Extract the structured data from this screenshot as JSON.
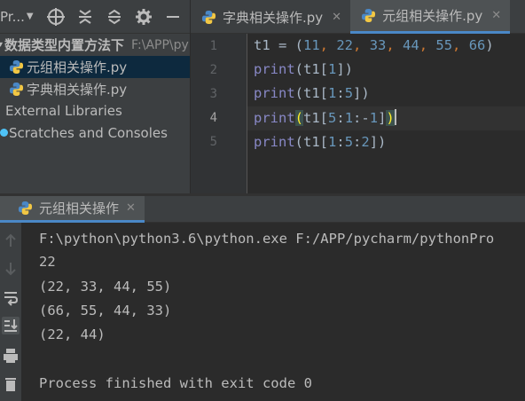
{
  "project_toolbar": {
    "title": "Pr...",
    "icons": [
      "locate-icon",
      "expand-all-icon",
      "collapse-all-icon",
      "gear-icon",
      "hide-icon"
    ]
  },
  "editor_tabs": [
    {
      "label": "字典相关操作.py",
      "active": false,
      "icon": "python-file-icon"
    },
    {
      "label": "元组相关操作.py",
      "active": true,
      "icon": "python-file-icon"
    }
  ],
  "project_tree": {
    "root_label": "数据类型内置方法下",
    "root_path": "F:\\APP\\py",
    "items": [
      {
        "label": "元组相关操作.py",
        "selected": true
      },
      {
        "label": "字典相关操作.py",
        "selected": false
      }
    ],
    "external_libraries": "External Libraries",
    "scratches": "Scratches and Consoles"
  },
  "editor": {
    "line_numbers": [
      "1",
      "2",
      "3",
      "4",
      "5"
    ],
    "current_line": 4,
    "lines": [
      "t1 = (11, 22, 33, 44, 55, 66)",
      "print(t1[1])",
      "print(t1[1:5])",
      "print(t1[5:1:-1])",
      "print(t1[1:5:2])"
    ]
  },
  "run_window": {
    "tab_label": "元组相关操作",
    "side_icons": [
      "up-arrow-icon",
      "down-arrow-icon",
      "soft-wrap-icon",
      "scroll-to-end-icon",
      "print-icon",
      "trash-icon"
    ],
    "output": [
      "F:\\python\\python3.6\\python.exe F:/APP/pycharm/pythonPro",
      "22",
      "(22, 33, 44, 55)",
      "(66, 55, 44, 33)",
      "(22, 44)",
      "",
      "Process finished with exit code 0"
    ]
  },
  "colors": {
    "background": "#2b2b2b",
    "panel": "#3c3f41",
    "accent": "#4a88c7",
    "selection": "#0d293e",
    "function": "#8888c6",
    "number": "#6897bb",
    "keyword_punct": "#cc7832"
  }
}
